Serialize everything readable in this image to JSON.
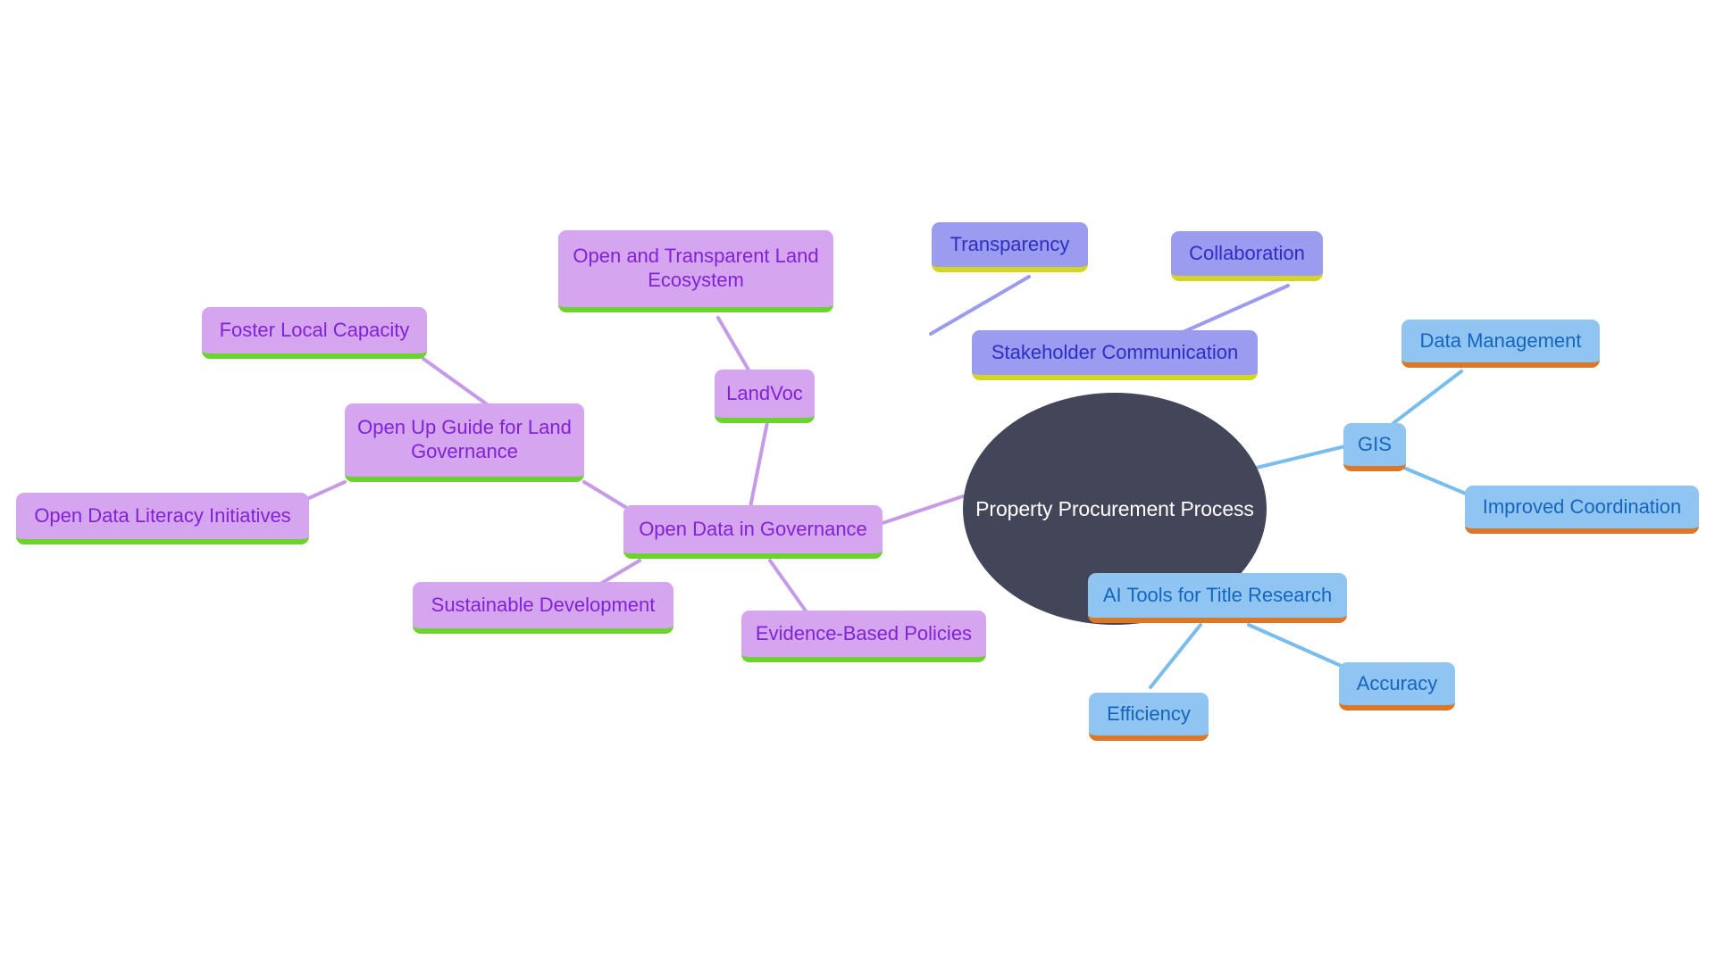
{
  "diagram": {
    "type": "mindmap",
    "title": "Property Procurement Process",
    "background_color": "#ffffff",
    "palettes": {
      "root": {
        "fill": "#434559",
        "text": "#ffffff"
      },
      "violet": {
        "fill": "#d6a5ef",
        "text": "#8122d6",
        "underline": "#6cd230",
        "edge": "#c79ae8"
      },
      "periwinkle": {
        "fill": "#9b9bf0",
        "text": "#2e2ec4",
        "underline": "#d4d422",
        "edge": "#9b9bf0"
      },
      "blue": {
        "fill": "#90c5f2",
        "text": "#1565c0",
        "underline": "#d9772a",
        "edge": "#79bdee"
      }
    }
  },
  "nodes": {
    "root": {
      "label": "Property Procurement Process"
    },
    "stakeholder_communication": {
      "label": "Stakeholder Communication"
    },
    "transparency": {
      "label": "Transparency"
    },
    "collaboration": {
      "label": "Collaboration"
    },
    "gis": {
      "label": "GIS"
    },
    "data_management": {
      "label": "Data Management"
    },
    "improved_coordination": {
      "label": "Improved Coordination"
    },
    "ai_tools": {
      "label": "AI Tools for Title Research"
    },
    "efficiency": {
      "label": "Efficiency"
    },
    "accuracy": {
      "label": "Accuracy"
    },
    "open_data_governance": {
      "label": "Open Data in Governance"
    },
    "open_up_guide": {
      "label": "Open Up Guide for Land Governance"
    },
    "landvoc": {
      "label": "LandVoc"
    },
    "open_transparent_land": {
      "label": "Open and Transparent Land Ecosystem"
    },
    "foster_local_capacity": {
      "label": "Foster Local Capacity"
    },
    "open_data_literacy": {
      "label": "Open Data Literacy Initiatives"
    },
    "sustainable_development": {
      "label": "Sustainable Development"
    },
    "evidence_based_policies": {
      "label": "Evidence-Based Policies"
    }
  },
  "chart_data": {
    "type": "diagram",
    "subtype": "mindmap",
    "root": "Property Procurement Process",
    "branches": [
      {
        "name": "Stakeholder Communication",
        "color_group": "periwinkle",
        "children": [
          "Transparency",
          "Collaboration"
        ]
      },
      {
        "name": "GIS",
        "color_group": "blue",
        "children": [
          "Data Management",
          "Improved Coordination"
        ]
      },
      {
        "name": "AI Tools for Title Research",
        "color_group": "blue",
        "children": [
          "Efficiency",
          "Accuracy"
        ]
      },
      {
        "name": "Open Data in Governance",
        "color_group": "violet",
        "children": [
          "Open Up Guide for Land Governance",
          "LandVoc",
          "Sustainable Development",
          "Evidence-Based Policies"
        ],
        "grandchildren": {
          "Open Up Guide for Land Governance": [
            "Foster Local Capacity",
            "Open Data Literacy Initiatives"
          ],
          "LandVoc": [
            "Open and Transparent Land Ecosystem"
          ]
        }
      }
    ],
    "edges": [
      {
        "from": "Property Procurement Process",
        "to": "Stakeholder Communication"
      },
      {
        "from": "Property Procurement Process",
        "to": "GIS"
      },
      {
        "from": "Property Procurement Process",
        "to": "AI Tools for Title Research"
      },
      {
        "from": "Property Procurement Process",
        "to": "Open Data in Governance"
      },
      {
        "from": "Stakeholder Communication",
        "to": "Transparency"
      },
      {
        "from": "Stakeholder Communication",
        "to": "Collaboration"
      },
      {
        "from": "GIS",
        "to": "Data Management"
      },
      {
        "from": "GIS",
        "to": "Improved Coordination"
      },
      {
        "from": "AI Tools for Title Research",
        "to": "Efficiency"
      },
      {
        "from": "AI Tools for Title Research",
        "to": "Accuracy"
      },
      {
        "from": "Open Data in Governance",
        "to": "Open Up Guide for Land Governance"
      },
      {
        "from": "Open Data in Governance",
        "to": "LandVoc"
      },
      {
        "from": "Open Data in Governance",
        "to": "Sustainable Development"
      },
      {
        "from": "Open Data in Governance",
        "to": "Evidence-Based Policies"
      },
      {
        "from": "Open Up Guide for Land Governance",
        "to": "Foster Local Capacity"
      },
      {
        "from": "Open Up Guide for Land Governance",
        "to": "Open Data Literacy Initiatives"
      },
      {
        "from": "LandVoc",
        "to": "Open and Transparent Land Ecosystem"
      }
    ],
    "node_count": 18,
    "edge_count": 17
  }
}
